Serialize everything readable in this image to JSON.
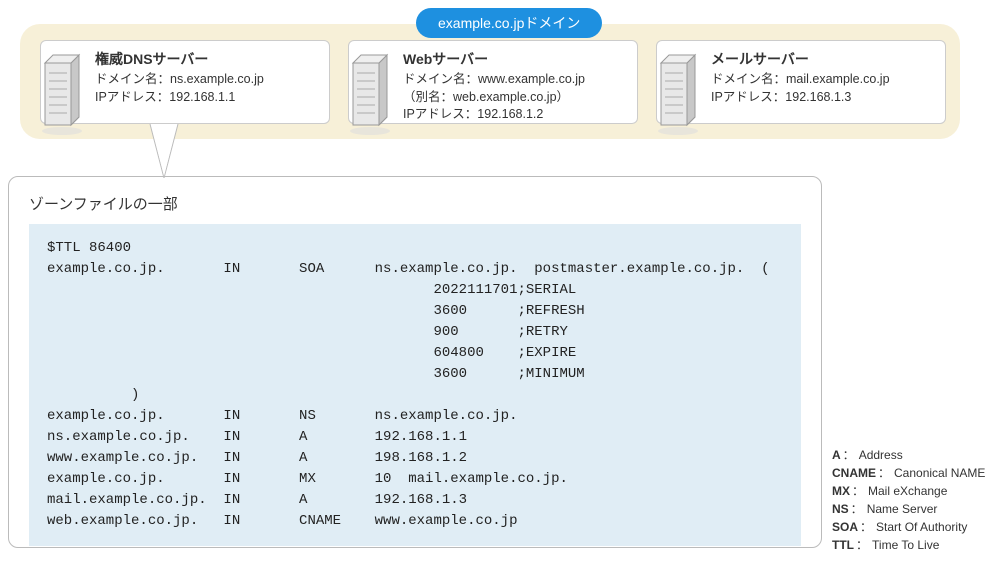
{
  "domain_badge": "example.co.jpドメイン",
  "servers": [
    {
      "title": "権威DNSサーバー",
      "line1": "ドメイン名：ns.example.co.jp",
      "line2": "IPアドレス：192.168.1.1",
      "line3": ""
    },
    {
      "title": "Webサーバー",
      "line1": "ドメイン名：www.example.co.jp",
      "line2": "（別名：web.example.co.jp）",
      "line3": "IPアドレス：192.168.1.2"
    },
    {
      "title": "メールサーバー",
      "line1": "ドメイン名：mail.example.co.jp",
      "line2": "IPアドレス：192.168.1.3",
      "line3": ""
    }
  ],
  "zone": {
    "title": "ゾーンファイルの一部",
    "lines": [
      "$TTL 86400",
      "example.co.jp.       IN       SOA      ns.example.co.jp.  postmaster.example.co.jp.  (",
      "                                              2022111701;SERIAL",
      "                                              3600      ;REFRESH",
      "                                              900       ;RETRY",
      "                                              604800    ;EXPIRE",
      "                                              3600      ;MINIMUM",
      "          )",
      "example.co.jp.       IN       NS       ns.example.co.jp.",
      "ns.example.co.jp.    IN       A        192.168.1.1",
      "www.example.co.jp.   IN       A        198.168.1.2",
      "example.co.jp.       IN       MX       10  mail.example.co.jp.",
      "mail.example.co.jp.  IN       A        192.168.1.3",
      "web.example.co.jp.   IN       CNAME    www.example.co.jp"
    ]
  },
  "legend": [
    {
      "key": "A",
      "val": "Address"
    },
    {
      "key": "CNAME",
      "val": "Canonical NAME"
    },
    {
      "key": "MX",
      "val": "Mail eXchange"
    },
    {
      "key": "NS",
      "val": "Name Server"
    },
    {
      "key": "SOA",
      "val": "Start Of Authority"
    },
    {
      "key": "TTL",
      "val": "Time To Live"
    }
  ]
}
